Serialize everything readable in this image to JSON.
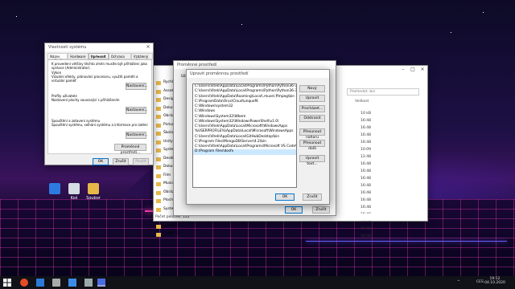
{
  "system_props": {
    "title": "Vlastnosti systému",
    "tabs": [
      "Název počítače",
      "Hardware",
      "Upřesnit",
      "Ochrana systému",
      "Vzdálený přístup"
    ],
    "admin_note": "K provedení většiny těchto změn musíte být přihlášeni jako správce (Administrator).",
    "perf_title": "Výkon",
    "perf_desc": "Vizuální efekty, plánování procesoru, využití paměti a virtuální paměť",
    "profiles_title": "Profily uživatele",
    "profiles_desc": "Nastavení plochy související s přihlášením",
    "startup_title": "Spouštění a zotavení systému",
    "startup_desc": "Spouštění systému, selhání systému a informace pro ladění",
    "settings_btn": "Nastavení...",
    "env_btn": "Proměnné prostředí...",
    "ok": "OK",
    "cancel": "Zrušit",
    "apply": "Použít"
  },
  "env_vars": {
    "title": "Proměnné prostředí",
    "user_label": "Uživ"
  },
  "edit_dialog": {
    "title": "Upravit proměnnou prostředí",
    "paths": [
      "C:\\Users\\Vitek\\AppData\\Local\\Programs\\Python\\Python36-32\\Scripts\\",
      "C:\\Users\\Vitek\\AppData\\Local\\Programs\\Python\\Python36-32\\",
      "C:\\Users\\Vitek\\AppData\\Roaming\\Local\\.muse\\.ffmpeg\\bin",
      "C:\\ProgramData\\Orus\\Cloud\\unquofit",
      "C:\\Windows\\system32",
      "C:\\Windows",
      "C:\\Windows\\System32\\Wbem",
      "C:\\Windows\\System32\\WindowsPowerShell\\v1.0\\",
      "C:\\Users\\Vitek\\AppData\\Local\\Microsoft\\WindowsApps",
      "%USERPROFILE%\\AppData\\Local\\Microsoft\\WindowsApps",
      "C:\\Users\\Vitek\\AppData\\Local\\GitHubDesktop\\bin",
      "C:\\Program Files\\MongoDB\\Server\\4.2\\bin",
      "C:\\Users\\Vitek\\AppData\\Local\\Programs\\Microsoft VS Code\\bin",
      "D:\\Program Files\\dosfx"
    ],
    "buttons": [
      "Nový",
      "Upravit",
      "Procházet...",
      "Odstranit",
      "Přesunout nahoru",
      "Přesunout dolů",
      "Upravit text..."
    ],
    "ok": "OK",
    "cancel": "Zrušit"
  },
  "env_footer": {
    "ok": "OK",
    "cancel": "Zrušit"
  },
  "explorer": {
    "search_placeholder": "Prohledat: bin",
    "col_header": "Velikost",
    "sidebar": [
      "Rychlý",
      "Assets",
      "Design",
      "Dokum",
      "Obráz",
      "Pictures",
      "Škola",
      "Unity Pr",
      "Syste",
      "Desktop",
      "Dokume",
      "Film",
      "Music",
      "Obrázky",
      "Plocha",
      "System",
      "Data (D",
      "Local D",
      "FLASH D"
    ],
    "times": [
      "10 kB",
      "16:48",
      "16:48",
      "16:48",
      "16:48",
      "10:09",
      "12:48",
      "16:48",
      "16:48",
      "16:48",
      "16:48",
      "16:48",
      "16:48",
      "16:48",
      "16:48",
      "16:48",
      "16:48",
      "16:48"
    ],
    "status": "Počet položek: 122"
  },
  "desktop_icons": [
    "",
    "",
    "Koš",
    "Soubor"
  ],
  "taskbar": {
    "time": "19:52",
    "date": "04.10.2020",
    "lang": "CES"
  },
  "colors": {
    "accent": "#0078d7",
    "selection": "#cce8ff",
    "taskbar": "#111118"
  }
}
